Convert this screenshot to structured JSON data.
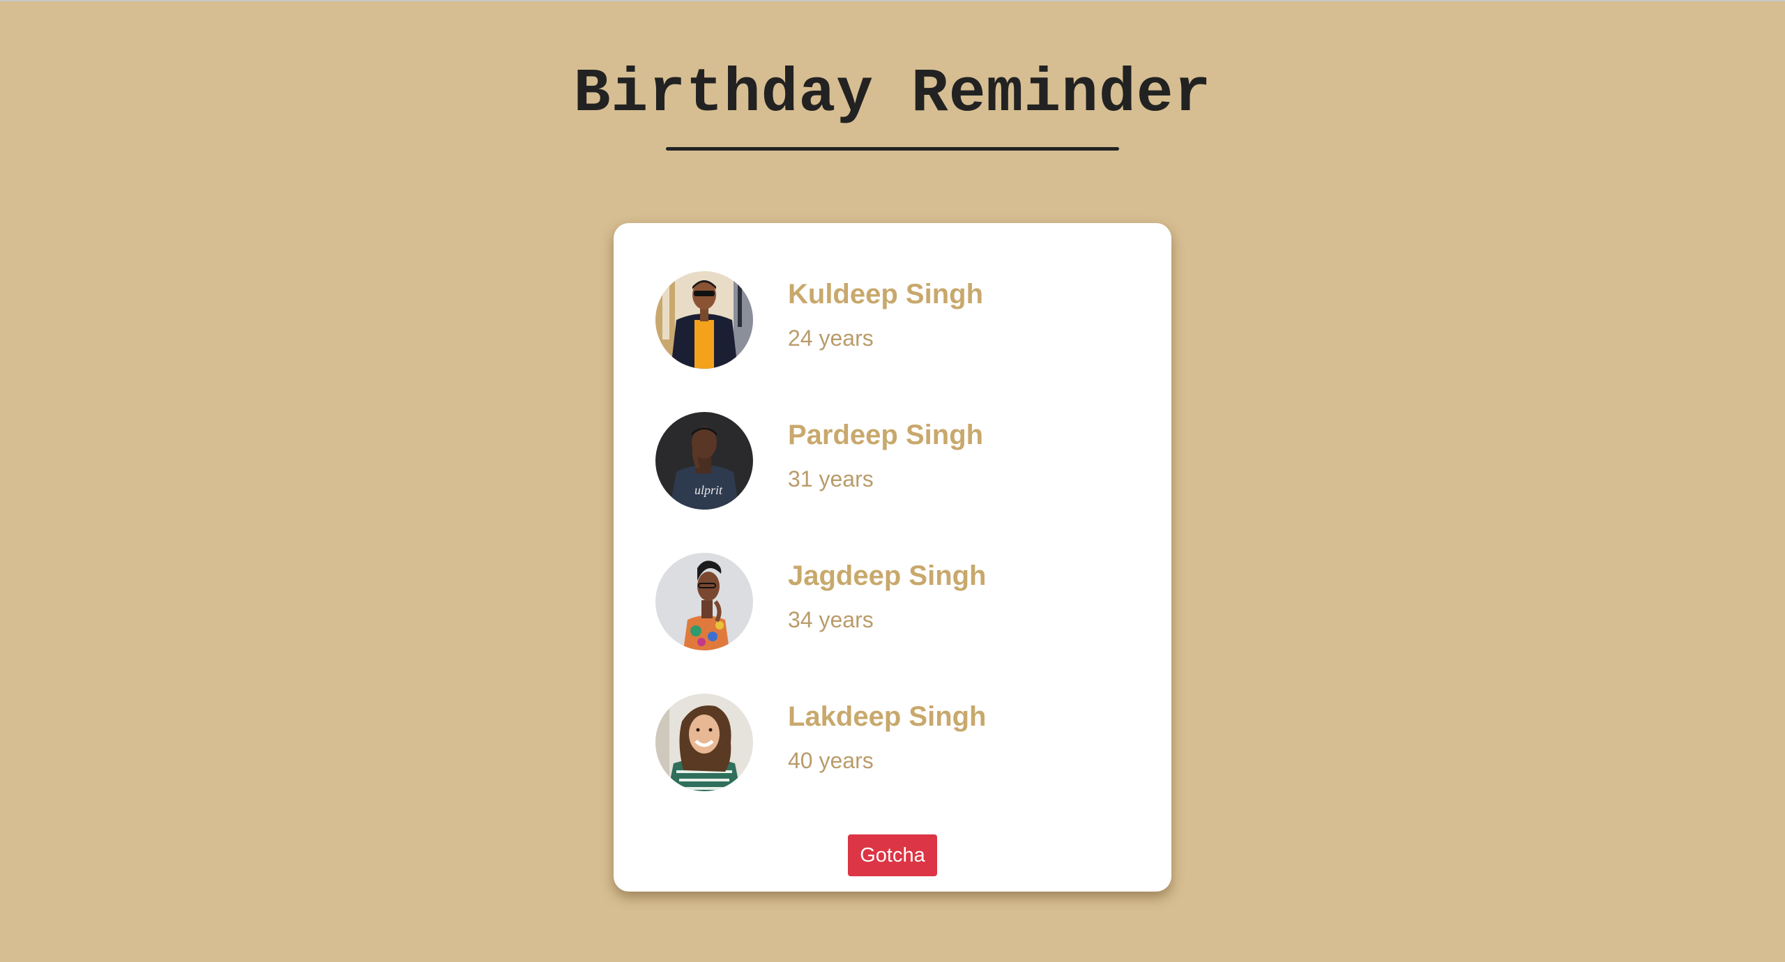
{
  "header": {
    "title": "Birthday Reminder"
  },
  "people": [
    {
      "name": "Kuldeep Singh",
      "age": "24 years",
      "avatar_icon": "person-photo-avatar"
    },
    {
      "name": "Pardeep Singh",
      "age": "31 years",
      "avatar_icon": "person-photo-avatar"
    },
    {
      "name": "Jagdeep Singh",
      "age": "34 years",
      "avatar_icon": "person-photo-avatar"
    },
    {
      "name": "Lakdeep Singh",
      "age": "40 years",
      "avatar_icon": "person-photo-avatar"
    }
  ],
  "actions": {
    "gotcha_label": "Gotcha"
  },
  "colors": {
    "background": "#d6be92",
    "card": "#ffffff",
    "name_text": "#c8a86c",
    "age_text": "#b99b6a",
    "title_text": "#222222",
    "button": "#dc3545"
  }
}
